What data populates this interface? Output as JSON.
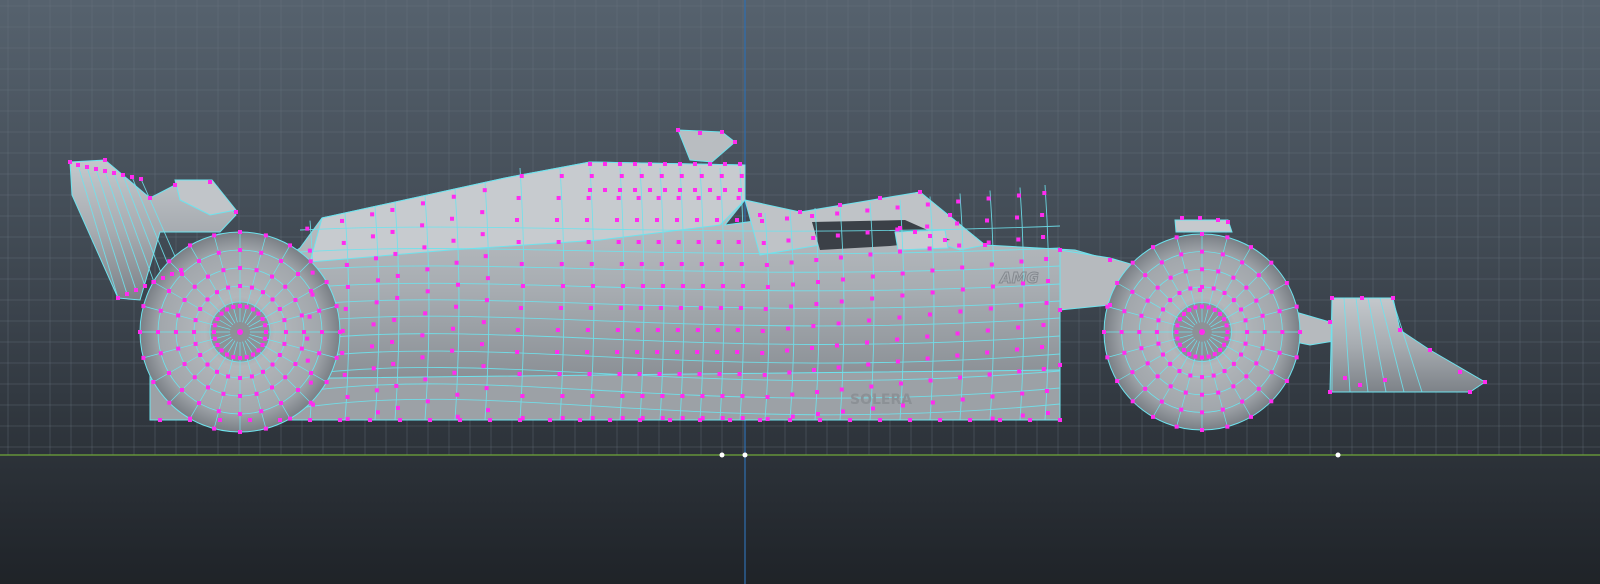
{
  "viewport": {
    "view": "side-orthographic",
    "background_top": "#56626e",
    "background_bottom": "#1f2328",
    "grid_color": "#6a7682",
    "ground_axis_color": "#6fa63a",
    "vertical_axis_color": "#2f6fb0",
    "mesh_fill": "#a9aeb3",
    "mesh_shadow": "#7b8087",
    "wire_color": "#6ee3ee",
    "vertex_color": "#ff2bf0"
  },
  "model": {
    "name_labels": [
      "AMG",
      "SOLERA"
    ],
    "object": "f1-car-polygon-mesh"
  }
}
